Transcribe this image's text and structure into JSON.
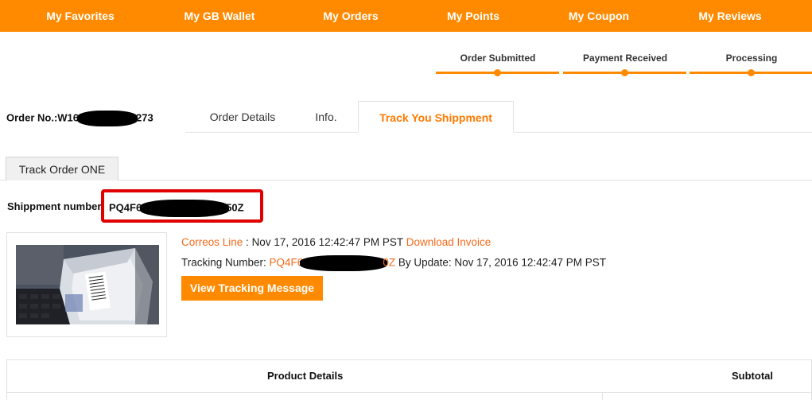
{
  "nav": {
    "items": [
      "My Favorites",
      "My GB Wallet",
      "My Orders",
      "My Points",
      "My Coupon",
      "My Reviews"
    ],
    "background": "#ff8a00"
  },
  "progress": {
    "steps": [
      "Order Submitted",
      "Payment Received",
      "Processing"
    ]
  },
  "order": {
    "label_prefix": "Order No.:W16",
    "label_suffix": "273"
  },
  "tabs": {
    "items": [
      "Order Details",
      "Info.",
      "Track You Shippment"
    ],
    "active": "Track You Shippment"
  },
  "track": {
    "subtab_label": "Track Order ONE",
    "shipment_label": "Shippment number",
    "shipment_prefix": "PQ4F6",
    "shipment_suffix": "50Z",
    "carrier": "Correos Line",
    "carrier_sep": " : ",
    "date": "Nov 17, 2016 12:42:47 PM PST",
    "download_invoice": "Download Invoice",
    "tracking_label": "Tracking Number: ",
    "tracking_prefix": "PQ4F6",
    "tracking_suffix": "0Z",
    "by_update": " By Update: Nov 17, 2016 12:42:47 PM PST",
    "view_button": "View Tracking Message"
  },
  "table": {
    "headers": [
      "Product Details",
      "Subtotal"
    ]
  },
  "colors": {
    "accent": "#ff8a00",
    "link": "#f26b1d",
    "highlight_border": "#e00000"
  }
}
